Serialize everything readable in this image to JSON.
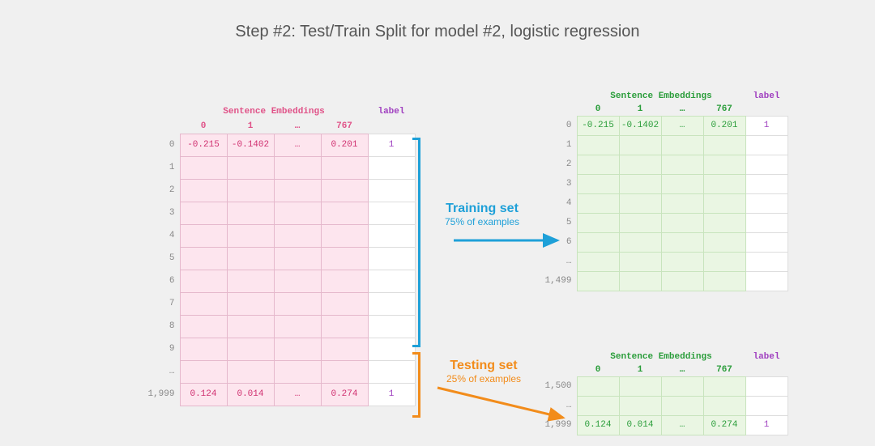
{
  "title": "Step #2: Test/Train Split for model #2, logistic regression",
  "headers": {
    "embeddings": "Sentence Embeddings",
    "label": "label",
    "cols": [
      "0",
      "1",
      "…",
      "767"
    ]
  },
  "left": {
    "rows": [
      "0",
      "1",
      "2",
      "3",
      "4",
      "5",
      "6",
      "7",
      "8",
      "9",
      "…",
      "1,999"
    ],
    "first": {
      "emb": [
        "-0.215",
        "-0.1402",
        "…",
        "0.201"
      ],
      "label": "1"
    },
    "last": {
      "emb": [
        "0.124",
        "0.014",
        "…",
        "0.274"
      ],
      "label": "1"
    }
  },
  "train": {
    "rows": [
      "0",
      "1",
      "2",
      "3",
      "4",
      "5",
      "6",
      "…",
      "1,499"
    ],
    "first": {
      "emb": [
        "-0.215",
        "-0.1402",
        "…",
        "0.201"
      ],
      "label": "1"
    }
  },
  "test": {
    "rows": [
      "1,500",
      "…",
      "1,999"
    ],
    "last": {
      "emb": [
        "0.124",
        "0.014",
        "…",
        "0.274"
      ],
      "label": "1"
    }
  },
  "mid": {
    "train_h": "Training set",
    "train_s": "75% of examples",
    "test_h": "Testing set",
    "test_s": "25% of examples"
  }
}
